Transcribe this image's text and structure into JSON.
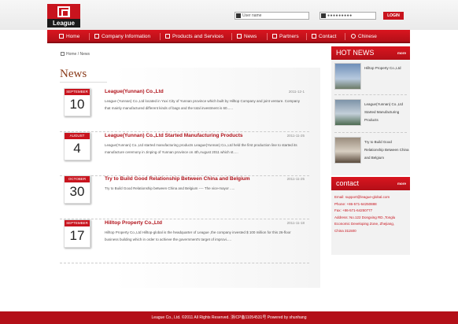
{
  "header": {
    "logo_text": "League",
    "username_placeholder": "User name",
    "password_mask": "●●●●●●●●●",
    "login_label": "LOGIN"
  },
  "nav": {
    "items": [
      {
        "label": "Home",
        "icon": "home-icon"
      },
      {
        "label": "Company Information",
        "icon": "company-icon"
      },
      {
        "label": "Products and Services",
        "icon": "products-icon"
      },
      {
        "label": "News",
        "icon": "news-icon"
      },
      {
        "label": "Partners",
        "icon": "partners-icon"
      },
      {
        "label": "Contact",
        "icon": "contact-icon"
      },
      {
        "label": "Chinese",
        "icon": "language-icon"
      }
    ]
  },
  "breadcrumb": "Home / News",
  "page_title": "News",
  "news": [
    {
      "month": "SEPTEMBER",
      "day": "10",
      "title": "League(Yunnan) Co.,Ltd",
      "date": "2011-12-1",
      "summary": "League (Yunnan) Co.,Ltd located in Yuxi City of Yunnan province which built by Hilltop Company and joint venture. Company that mainly manufactured different kinds of bags and the total investment is 60......"
    },
    {
      "month": "AUGUST",
      "day": "4",
      "title": "League(Yunnan) Co.,Ltd Started Manufacturing Products",
      "date": "2011-11-25",
      "summary": "League(Yunnan) Co.,Ltd started manufacturing products League(Yunnan) Co.,Ltd held the first production line to started its manufacture ceremony in Jinping of Yunnan province on 4th,August 2011 which st....."
    },
    {
      "month": "OCTOBER",
      "day": "30",
      "title": "Try to Build Good Relationship Between China and Belgium",
      "date": "2011-11-25",
      "summary": "Try to Build Good Relationship between China and Belgium ---- The vice-mayor ....."
    },
    {
      "month": "SEPTEMBER",
      "day": "17",
      "title": "Hilltop Property Co.,Ltd",
      "date": "2011-11-18",
      "summary": "Hilltop Property Co.,Ltd Hilltop-global is the headquarter of League ,the company invested $ 100 million for this 26-floor business building which in order to achieve the government's target of improvi....."
    }
  ],
  "sidebar": {
    "hot_news_title": "HOT NEWS",
    "more_label": "more",
    "hot_items": [
      {
        "text": "Hilltop Property Co.,Ltd"
      },
      {
        "text": "League(Yunnan) Co.,Ltd Started Manufacturing Products"
      },
      {
        "text": "Try to Build Good Relationship Between China and Belgium"
      }
    ],
    "contact_title": "contact",
    "contact_lines": [
      "Email: support@league-global.com",
      "Phone: +86-571-64250888",
      "Fax: +86-571-64250777",
      "Address: No.122 Dongxing RD.,Tonglu",
      "Economic Developing Zone, Zhejiang,",
      "China 311500"
    ]
  },
  "footer": "League Co., Ltd. ©2011 All Rights Reserved. 浙ICP备11054531号  Powered by shunhang"
}
